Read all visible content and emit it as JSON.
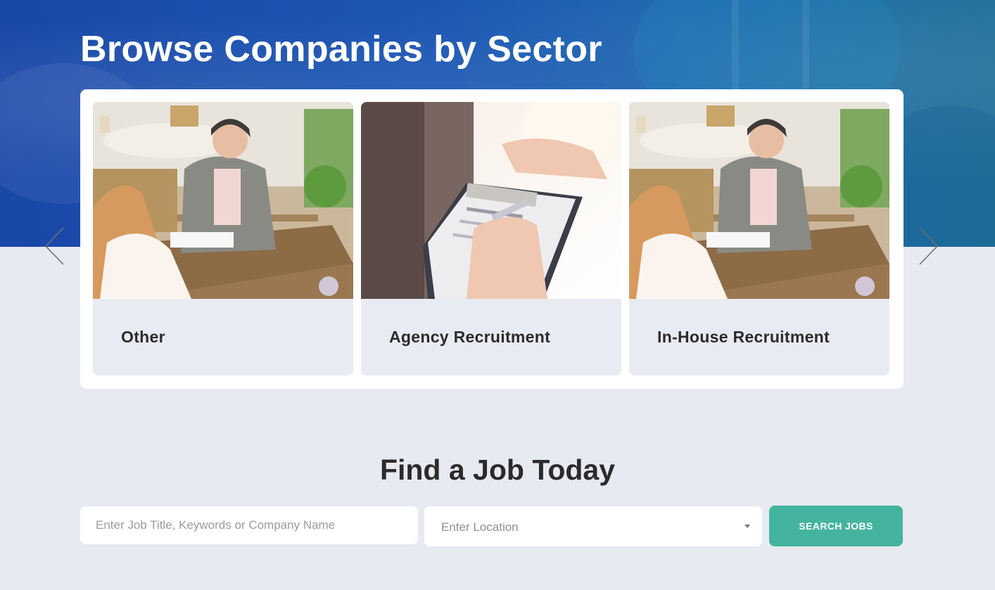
{
  "hero": {
    "title": "Browse Companies by Sector"
  },
  "sectors": {
    "cards": [
      {
        "label": "Other",
        "image": "interview-at-cafe-table-photo"
      },
      {
        "label": "Agency Recruitment",
        "image": "resume-clipboard-photo"
      },
      {
        "label": "In-House Recruitment",
        "image": "interview-at-cafe-table-photo"
      }
    ],
    "prev_icon": "chevron-left-icon",
    "next_icon": "chevron-right-icon"
  },
  "job_search": {
    "title": "Find a Job Today",
    "keyword_placeholder": "Enter Job Title, Keywords or Company Name",
    "location_placeholder": "Enter Location",
    "button_label": "SEARCH JOBS"
  },
  "colors": {
    "hero_blue": "#1c57b4",
    "page_background": "#e8eaf2",
    "button_teal": "#44b49f",
    "text_dark": "#2b2b2b"
  }
}
